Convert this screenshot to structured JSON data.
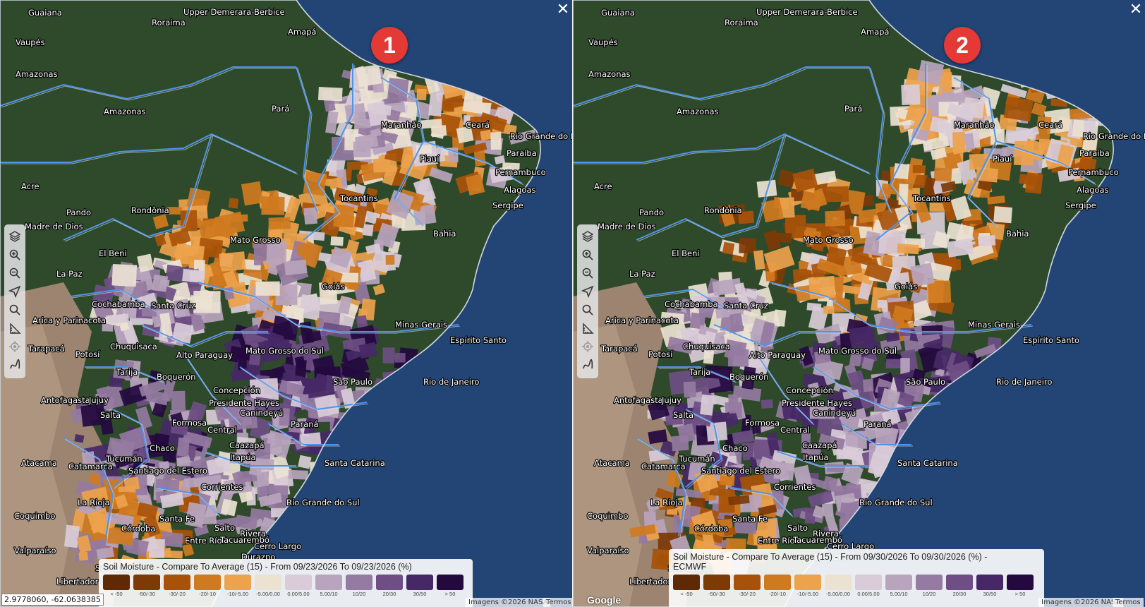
{
  "panes": [
    {
      "badge": "1",
      "legend_title": "Soil Moisture - Compare To Average (15) - From 09/23/2026 To 09/23/2026 (%)",
      "coords": "2.9778060, -62.0638385",
      "attribution": "Imagens ©2026 NASA",
      "terms": "Termos"
    },
    {
      "badge": "2",
      "legend_title": "Soil Moisture - Compare To Average (15) - From 09/30/2026 To 09/30/2026 (%) -\nECMWF",
      "attribution": "Imagens ©2026 NASA",
      "terms": "Termos",
      "google": "Google"
    }
  ],
  "legend": [
    {
      "label": "< -50",
      "color": "#5e2a06"
    },
    {
      "label": "-50/-30",
      "color": "#7c3a06"
    },
    {
      "label": "-30/-20",
      "color": "#a85209"
    },
    {
      "label": "-20/-10",
      "color": "#cf7a1f"
    },
    {
      "label": "-10/-5.00",
      "color": "#eda24c"
    },
    {
      "label": "-5.00/0.00",
      "color": "#ece2d2"
    },
    {
      "label": "0.00/5.00",
      "color": "#d9ccd8"
    },
    {
      "label": "5.00/10",
      "color": "#b8a4bd"
    },
    {
      "label": "10/20",
      "color": "#957aa1"
    },
    {
      "label": "20/30",
      "color": "#6e4e84"
    },
    {
      "label": "30/50",
      "color": "#472866"
    },
    {
      "label": "> 50",
      "color": "#24093f"
    }
  ],
  "place_labels": [
    "Guaiana",
    "Upper Demerara-Berbice",
    "Roraima",
    "Amapá",
    "Vaupés",
    "Amazonas",
    "Amazonas",
    "Pará",
    "Maranhão",
    "Ceará",
    "Rio Grande do Norte",
    "Piauí",
    "Paraíba",
    "Pernambuco",
    "Acre",
    "Tocantins",
    "Alagoas",
    "Sergipe",
    "Pando",
    "Rondônia",
    "Madre de Dios",
    "Mato Grosso",
    "Bahia",
    "El Beni",
    "La Paz",
    "Goiás",
    "Cochabamba",
    "Santa Cruz",
    "Arica y Parinacota",
    "Minas Gerais",
    "Chuquisaca",
    "Alto Paraguay",
    "Espírito Santo",
    "Tarapacá",
    "Potosí",
    "Mato Grosso do Sul",
    "Tarija",
    "Boquerón",
    "São Paulo",
    "Rio de Janeiro",
    "Antofagasta",
    "Jujuy",
    "Concepción",
    "Presidente Hayes",
    "Canindeyú",
    "Salta",
    "Formosa",
    "Central",
    "Caazapá",
    "Itapúa",
    "Paraná",
    "Tucumán",
    "Chaco",
    "Catamarca",
    "Atacama",
    "Santiago del Estero",
    "Santa Catarina",
    "Corrientes",
    "La Rioja",
    "Rio Grande do Sul",
    "Coquimbo",
    "Santa Fe",
    "Salto",
    "Córdoba",
    "Entre Ríos",
    "Tacuarembó",
    "Rivera",
    "Cerro Largo",
    "Durazno",
    "Valparaíso",
    "San Luis",
    "Libertador General Bernardo O'Higgins"
  ],
  "tools": [
    "layers-icon",
    "zoom-in-icon",
    "zoom-out-icon",
    "navigate-icon",
    "search-icon",
    "measure-icon",
    "locate-icon",
    "draw-icon"
  ]
}
